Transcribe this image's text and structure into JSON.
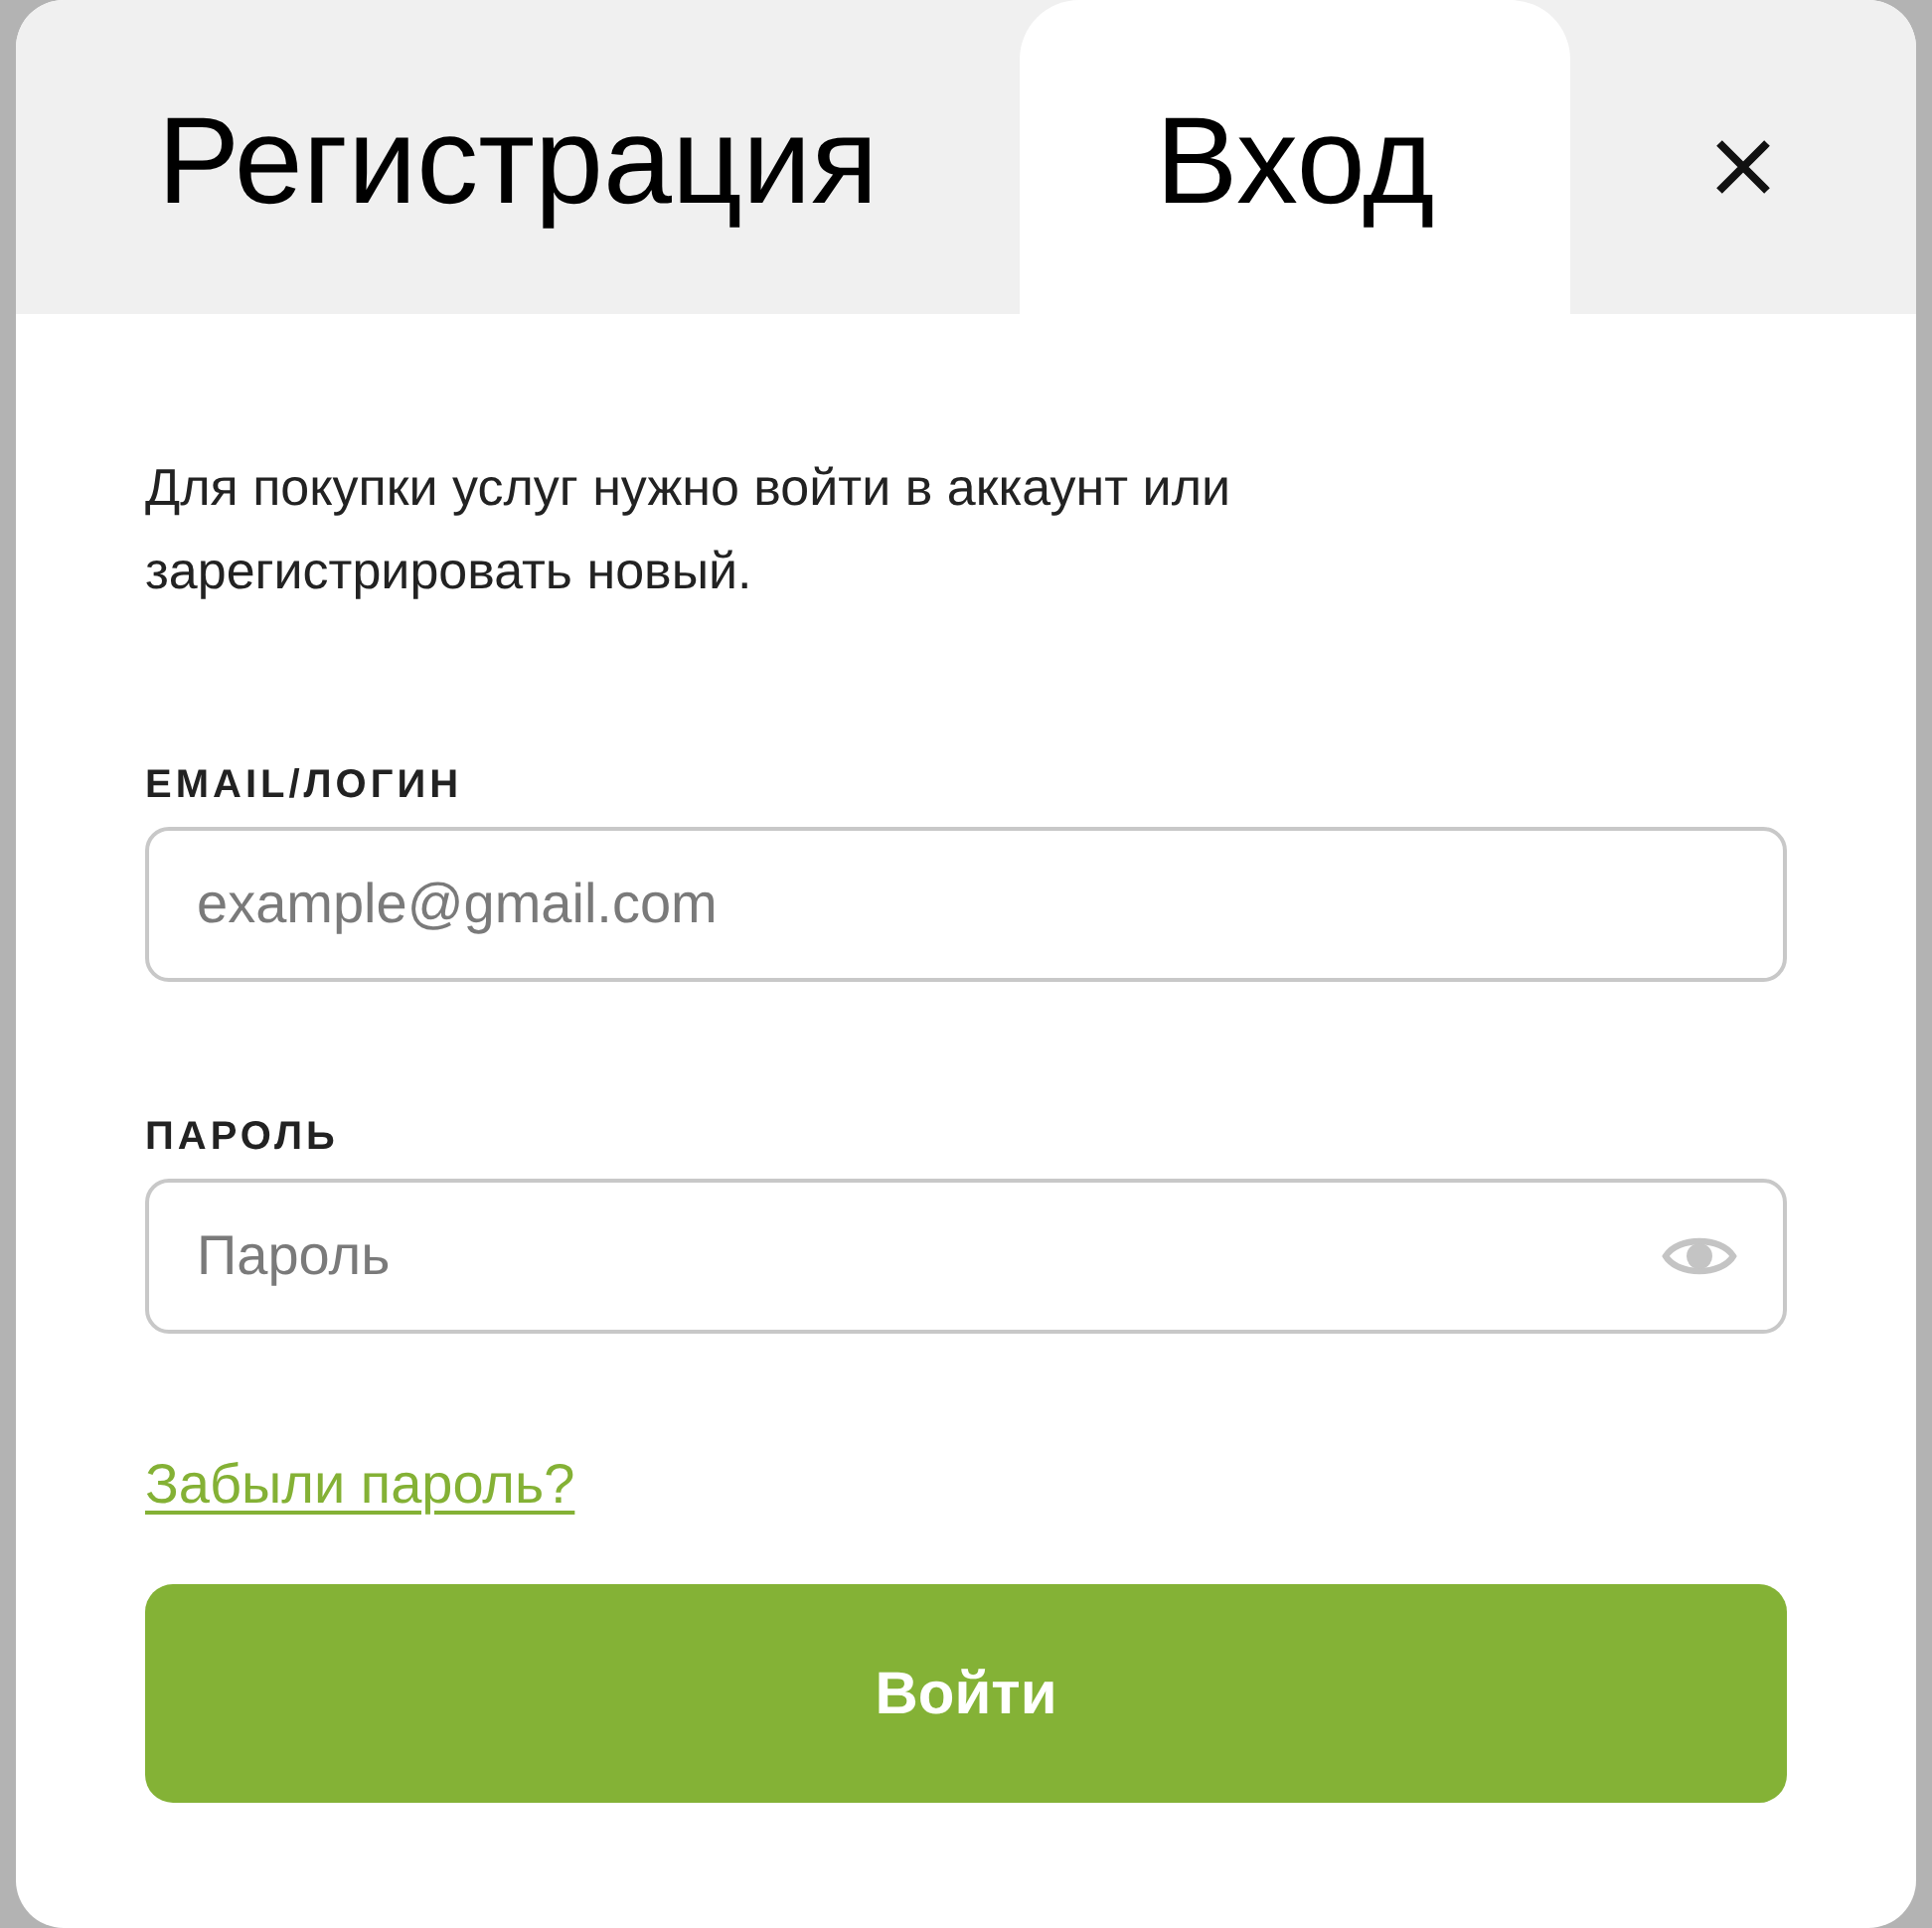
{
  "tabs": [
    {
      "label": "Регистрация",
      "selected": false
    },
    {
      "label": "Вход",
      "selected": true
    }
  ],
  "intro": "Для покупки услуг нужно войти в аккаунт или зарегистрировать новый.",
  "fields": [
    {
      "kind": "text",
      "label": "EMAIL/ЛОГИН",
      "placeholder": "example@gmail.com"
    },
    {
      "kind": "password",
      "label": "ПАРОЛЬ",
      "placeholder": "Пароль"
    }
  ],
  "forgot_link": "Забыли пароль?",
  "submit_button": "Войти"
}
